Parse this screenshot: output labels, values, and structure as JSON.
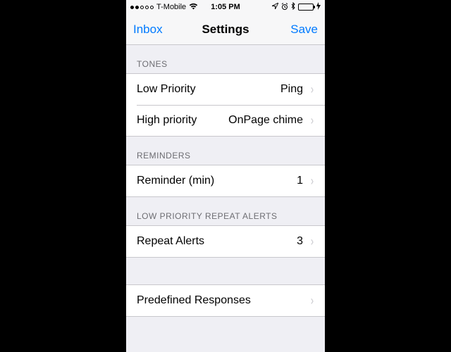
{
  "status": {
    "carrier": "T-Mobile",
    "time": "1:05 PM"
  },
  "nav": {
    "back": "Inbox",
    "title": "Settings",
    "save": "Save"
  },
  "sections": {
    "tones": {
      "header": "Tones",
      "low_label": "Low Priority",
      "low_value": "Ping",
      "high_label": "High priority",
      "high_value": "OnPage chime"
    },
    "reminders": {
      "header": "Reminders",
      "reminder_label": "Reminder (min)",
      "reminder_value": "1"
    },
    "low_repeat": {
      "header": "Low Priority Repeat Alerts",
      "repeat_label": "Repeat Alerts",
      "repeat_value": "3"
    },
    "predefined": {
      "label": "Predefined Responses"
    }
  }
}
